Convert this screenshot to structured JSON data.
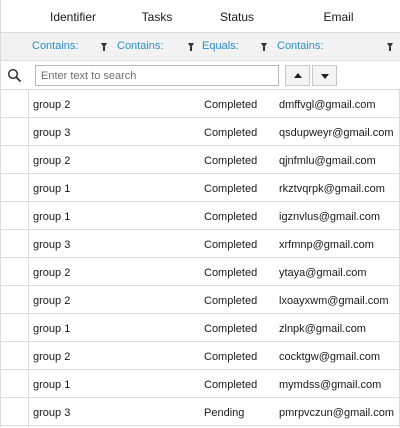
{
  "columns": [
    {
      "key": "identifier",
      "label": "Identifier"
    },
    {
      "key": "tasks",
      "label": "Tasks"
    },
    {
      "key": "status",
      "label": "Status"
    },
    {
      "key": "email",
      "label": "Email"
    }
  ],
  "filters": [
    {
      "label": "Contains:"
    },
    {
      "label": "Contains:"
    },
    {
      "label": "Equals:"
    },
    {
      "label": "Contains:"
    }
  ],
  "search": {
    "placeholder": "Enter text to search",
    "value": ""
  },
  "rows": [
    {
      "identifier": "group 2",
      "tasks": "",
      "status": "Completed",
      "email": "dmffvgl@gmail.com"
    },
    {
      "identifier": "group 3",
      "tasks": "",
      "status": "Completed",
      "email": "qsdupweyr@gmail.com"
    },
    {
      "identifier": "group 2",
      "tasks": "",
      "status": "Completed",
      "email": "qjnfmlu@gmail.com"
    },
    {
      "identifier": "group 1",
      "tasks": "",
      "status": "Completed",
      "email": "rkztvqrpk@gmail.com"
    },
    {
      "identifier": "group 1",
      "tasks": "",
      "status": "Completed",
      "email": "igznvlus@gmail.com"
    },
    {
      "identifier": "group 3",
      "tasks": "",
      "status": "Completed",
      "email": "xrfmnp@gmail.com"
    },
    {
      "identifier": "group 2",
      "tasks": "",
      "status": "Completed",
      "email": "ytaya@gmail.com"
    },
    {
      "identifier": "group 2",
      "tasks": "",
      "status": "Completed",
      "email": "lxoayxwm@gmail.com"
    },
    {
      "identifier": "group 1",
      "tasks": "",
      "status": "Completed",
      "email": "zlnpk@gmail.com"
    },
    {
      "identifier": "group 2",
      "tasks": "",
      "status": "Completed",
      "email": "cocktgw@gmail.com"
    },
    {
      "identifier": "group 1",
      "tasks": "",
      "status": "Completed",
      "email": "mymdss@gmail.com"
    },
    {
      "identifier": "group 3",
      "tasks": "",
      "status": "Pending",
      "email": "pmrpvczun@gmail.com"
    }
  ],
  "colors": {
    "filter_label": "#2a8fc9",
    "border": "#dcdcdc",
    "filter_bg": "#f2f2f2"
  }
}
